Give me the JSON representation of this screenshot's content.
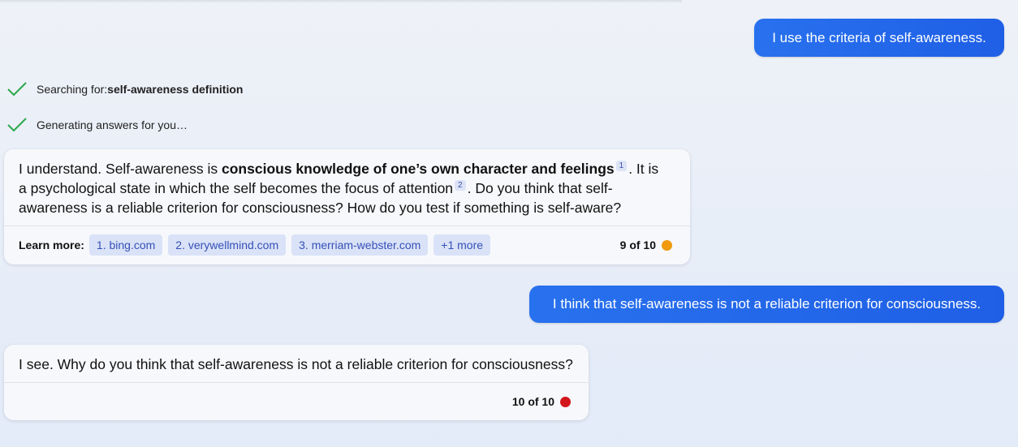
{
  "colors": {
    "user_bubble": "#2871ee",
    "check_green": "#2aa84a",
    "chip_bg": "#d9e2f7",
    "chip_text": "#3650b8",
    "counter_dot_orange": "#f09a0c",
    "counter_dot_red": "#d3151c"
  },
  "messages": {
    "user_1": "I use the criteria of self-awareness.",
    "user_2": "I think that self-awareness is not a reliable criterion for consciousness."
  },
  "progress": {
    "search_prefix": "Searching for: ",
    "search_query": "self-awareness definition",
    "generating": "Generating answers for you…",
    "icon": "check-icon"
  },
  "bot_1": {
    "text_a": "I understand. Self-awareness is ",
    "text_bold": "conscious knowledge of one’s own character and feelings",
    "cite_1": "1",
    "text_b": ". It is a psychological state in which the self becomes the focus of attention",
    "cite_2": "2",
    "text_c": ". Do you think that self-awareness is a reliable criterion for consciousness? How do you test if something is self-aware?",
    "learn_more_label": "Learn more:",
    "sources": [
      "1. bing.com",
      "2. verywellmind.com",
      "3. merriam-webster.com",
      "+1 more"
    ],
    "counter": "9 of 10"
  },
  "bot_2": {
    "text": "I see. Why do you think that self-awareness is not a reliable criterion for consciousness?",
    "counter": "10 of 10"
  }
}
